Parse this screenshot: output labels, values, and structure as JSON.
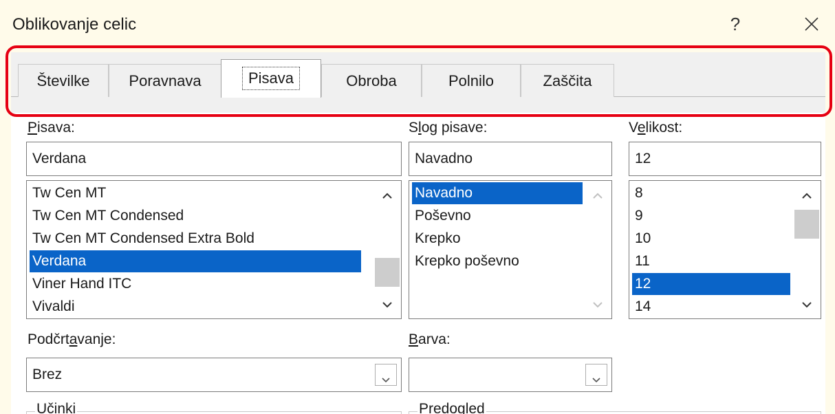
{
  "dialog": {
    "title": "Oblikovanje celic",
    "help_glyph": "?",
    "close_icon": "close-icon"
  },
  "tabs": [
    {
      "label": "Številke",
      "active": false
    },
    {
      "label": "Poravnava",
      "active": false
    },
    {
      "label": "Pisava",
      "active": true
    },
    {
      "label": "Obroba",
      "active": false
    },
    {
      "label": "Polnilo",
      "active": false
    },
    {
      "label": "Zaščita",
      "active": false
    }
  ],
  "highlight_color": "#e60012",
  "selection_color": "#0a64c8",
  "font": {
    "label": "Pisava:",
    "label_accel": "P",
    "label_rest": "isava:",
    "value": "Verdana",
    "list": [
      "Tw Cen MT",
      "Tw Cen MT Condensed",
      "Tw Cen MT Condensed Extra Bold",
      "Verdana",
      "Viner Hand ITC",
      "Vivaldi"
    ],
    "selected": "Verdana"
  },
  "font_style": {
    "label": "Slog pisave:",
    "label_pre": "S",
    "label_accel": "l",
    "label_rest": "og pisave:",
    "value": "Navadno",
    "list": [
      "Navadno",
      "Poševno",
      "Krepko",
      "Krepko poševno"
    ],
    "selected": "Navadno"
  },
  "size": {
    "label": "Velikost:",
    "label_pre": "V",
    "label_accel": "e",
    "label_rest": "likost:",
    "value": "12",
    "list": [
      "8",
      "9",
      "10",
      "11",
      "12",
      "14"
    ],
    "selected": "12"
  },
  "underline": {
    "label": "Podčrtavanje:",
    "label_pre": "Podčrt",
    "label_accel": "a",
    "label_rest": "vanje:",
    "value": "Brez"
  },
  "color": {
    "label": "Barva:",
    "label_accel": "B",
    "label_rest": "arva:",
    "value": ""
  },
  "effects": {
    "legend": "Učinki"
  },
  "preview": {
    "legend": "Predogled"
  }
}
